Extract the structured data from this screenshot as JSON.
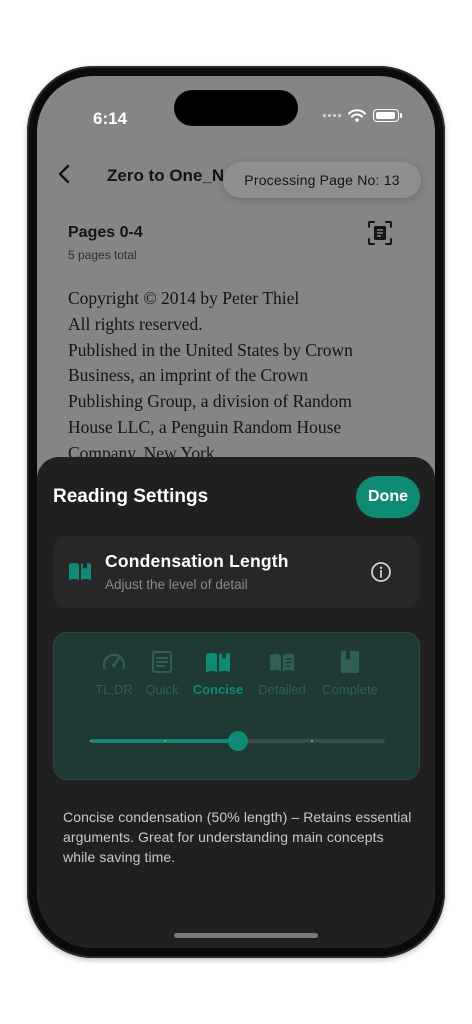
{
  "status_bar": {
    "time": "6:14",
    "icons": [
      "signal-icon",
      "wifi-icon",
      "battery-icon"
    ]
  },
  "nav": {
    "title": "Zero to One_N",
    "back_icon": "chevron-left-icon"
  },
  "toast": {
    "text": "Processing Page No: 13"
  },
  "reader": {
    "pages_title": "Pages 0-4",
    "pages_sub": "5 pages total",
    "lines": [
      "Copyright © 2014 by Peter Thiel",
      "All rights reserved.",
      "Published in the United States by Crown",
      "Business, an imprint of the Crown",
      "Publishing Group, a division of Random",
      "House LLC, a Penguin Random House",
      "Company, New York."
    ]
  },
  "sheet": {
    "title": "Reading Settings",
    "done_label": "Done",
    "card": {
      "title": "Condensation Length",
      "subtitle": "Adjust the level of detail"
    },
    "levels": [
      {
        "label": "TL;DR",
        "icon": "gauge-icon"
      },
      {
        "label": "Quick",
        "icon": "list-icon"
      },
      {
        "label": "Concise",
        "icon": "open-book-icon"
      },
      {
        "label": "Detailed",
        "icon": "book-pages-icon"
      },
      {
        "label": "Complete",
        "icon": "closed-book-icon"
      }
    ],
    "selected_index": 2,
    "slider_value_percent": 50,
    "description": "Concise condensation (50% length) – Retains essential arguments. Great for understanding main concepts while saving time."
  },
  "colors": {
    "accent": "#0f8a74",
    "sheet_bg": "#202020",
    "dim_bg": "#858585"
  }
}
